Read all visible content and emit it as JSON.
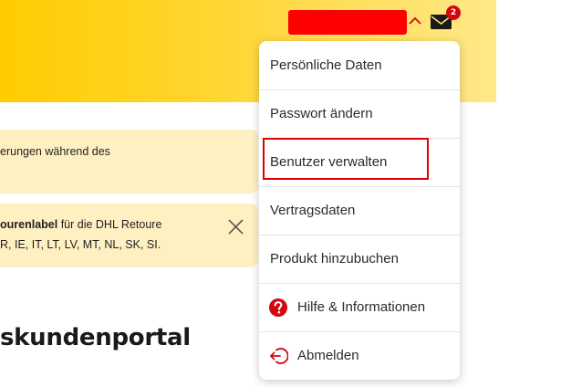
{
  "header": {
    "mail_badge_count": "2",
    "colors": {
      "brand_yellow": "#ffcc00",
      "brand_red": "#d40511"
    }
  },
  "notices": {
    "first": {
      "text": "erungen während des"
    },
    "second": {
      "line1_bold": "ourenlabel",
      "line1_rest": " für die DHL Retoure",
      "line2": "R, IE, IT, LT, LV, MT, NL, SK, SI."
    }
  },
  "page": {
    "heading": "skundenportal"
  },
  "menu": {
    "items": [
      {
        "label": "Persönliche Daten"
      },
      {
        "label": "Passwort ändern"
      },
      {
        "label": "Benutzer verwalten"
      },
      {
        "label": "Vertragsdaten"
      },
      {
        "label": "Produkt hinzubuchen"
      },
      {
        "label": "Hilfe & Informationen",
        "icon": "help-icon"
      },
      {
        "label": "Abmelden",
        "icon": "logout-icon"
      }
    ]
  }
}
